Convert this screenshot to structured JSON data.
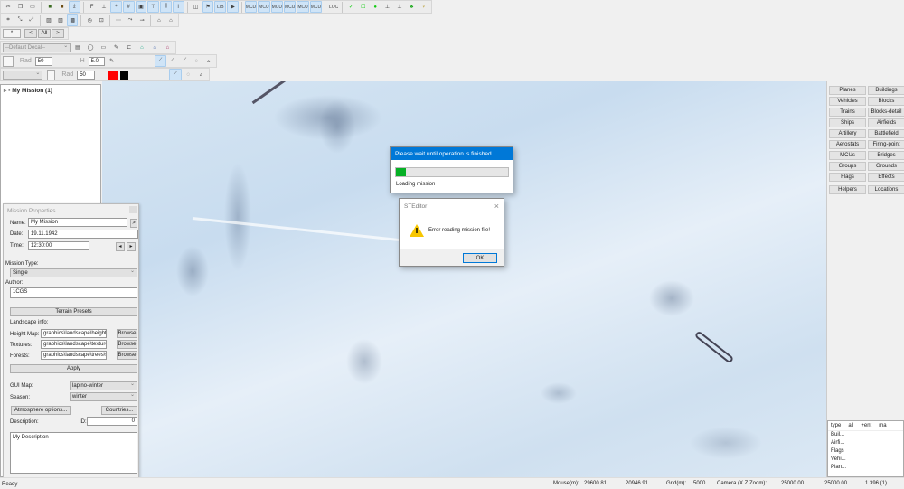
{
  "toolbar": {
    "row1_icons": [
      "cut-icon",
      "copy-icon",
      "paste-icon",
      "|",
      "terrain-icon",
      "terrain-alt-icon",
      "download-icon",
      "|",
      "font-icon",
      "anchor-icon",
      "snap-icon",
      "grid-icon",
      "frame-icon",
      "align-icon",
      "distribute-icon",
      "info-icon",
      "|",
      "dst-icon",
      "flag-icon",
      "lib-icon",
      "bp-icon",
      "|",
      "mcu-icon",
      "mcu-icon",
      "mcu-icon",
      "mcu-icon",
      "mcu-icon",
      "mcu-icon",
      "|",
      "loc-icon",
      "|",
      "check-icon",
      "box-icon",
      "dot-icon",
      "ruler-icon",
      "ruler-alt-icon",
      "tree-icon",
      "bulb-icon"
    ],
    "row1_text": {
      "mcu": "MCU",
      "loc": "LOC",
      "lib": "LIB"
    },
    "row2_icons": [
      "select-icon",
      "select-path-icon",
      "select-group-icon",
      "|",
      "image-icon",
      "image-alt-icon",
      "pattern-icon",
      "|",
      "circle-icon",
      "rect-icon",
      "|",
      "path-icon",
      "path-alt-icon",
      "waypoint-icon",
      "|",
      "object-icon",
      "object-alt-icon"
    ],
    "nav": {
      "star": "*",
      "prev": "<",
      "all": "All",
      "next": ">"
    },
    "decal_select": "--Default Decal--",
    "rad_label": "Rad",
    "rad_value": "50",
    "h_label": "H",
    "h_value": "5.0",
    "rad2_label": "Rad",
    "rad2_value": "50",
    "color_red": "#ff0000",
    "color_black": "#000000"
  },
  "tree": {
    "root": "My Mission (1)"
  },
  "mission_properties": {
    "title": "Mission Properties",
    "name_label": "Name:",
    "name_value": "My Mission",
    "name_btn": ">",
    "date_label": "Date:",
    "date_value": "19.11.1942",
    "time_label": "Time:",
    "time_value": "12:30:00",
    "type_label": "Mission Type:",
    "type_value": "Single",
    "author_label": "Author:",
    "author_value": "1CGS",
    "terrain_presets": "Terrain Presets",
    "landscape_label": "Landscape info:",
    "height_label": "Height Map:",
    "height_value": "graphics\\landscape\\height.I",
    "textures_label": "Textures:",
    "textures_value": "graphics\\landscape\\texture",
    "forests_label": "Forests:",
    "forests_value": "graphics\\landscape\\trees\\w",
    "browse": "Browse",
    "apply": "Apply",
    "gui_label": "GUI Map:",
    "gui_value": "lapino-winter",
    "season_label": "Season:",
    "season_value": "winter",
    "atmosphere": "Atmosphere options...",
    "countries": "Countries...",
    "desc_label": "Description:",
    "id_label": "ID:",
    "id_value": "0",
    "desc_value": "My Description"
  },
  "right_panel": {
    "buttons": [
      "Planes",
      "Buildings",
      "Vehicles",
      "Blocks",
      "Trains",
      "Blocks-detail",
      "Ships",
      "Airfields",
      "Artillery",
      "Battlefield",
      "Aerostats",
      "Firing-point",
      "MCUs",
      "Bridges",
      "Groups",
      "Grounds",
      "Flags",
      "Effects",
      "Helpers",
      "Locations"
    ],
    "list_headers": [
      "type",
      "all",
      "+ent",
      "ma"
    ],
    "list_items": [
      "Buil...",
      "Airfi...",
      "Flags",
      "Vehi...",
      "Plan..."
    ]
  },
  "progress": {
    "title": "Please wait until operation is finished",
    "text": "Loading mission",
    "percent": 9,
    "bar_color": "#06b025",
    "title_color": "#0078d7"
  },
  "error": {
    "title": "STEditor",
    "message": "Error reading mission file!",
    "ok": "OK"
  },
  "status": {
    "ready": "Ready",
    "mouse_label": "Mouse(m):",
    "mouse_x": "29600.81",
    "mouse_z": "20946.91",
    "grid_label": "Grid(m):",
    "grid_value": "5000",
    "camera_label": "Camera (X  Z  Zoom):",
    "cam_x": "25000.00",
    "cam_z": "25000.00",
    "cam_zoom": "1.396 (1)"
  }
}
